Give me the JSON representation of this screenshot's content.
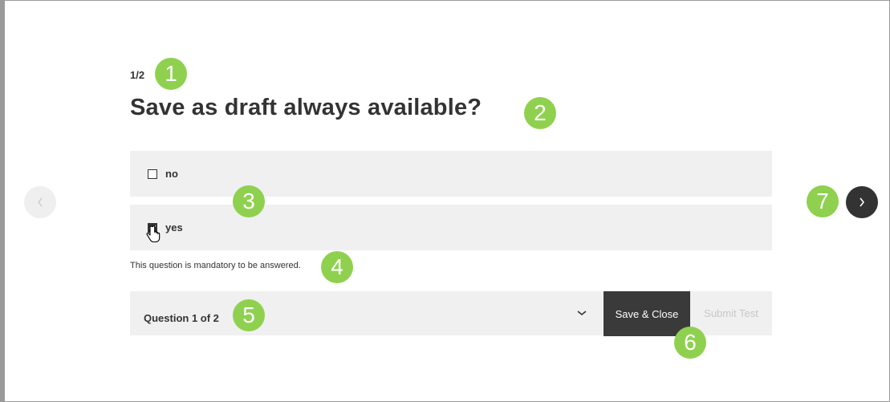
{
  "question": {
    "progress": "1/2",
    "title": "Save as draft always available?",
    "options": [
      {
        "label": "no",
        "checked": false
      },
      {
        "label": "yes",
        "checked": true
      }
    ],
    "mandatory_note": "This question is mandatory to be answered."
  },
  "footer": {
    "question_selector": "Question 1 of 2",
    "save_close_label": "Save & Close",
    "submit_label": "Submit Test"
  },
  "markers": [
    "1",
    "2",
    "3",
    "4",
    "5",
    "6",
    "7"
  ],
  "colors": {
    "marker": "#8fd14f",
    "dark_button": "#3a3a3a",
    "panel": "#f0f0f0",
    "disabled_text": "#c8c8c8"
  },
  "icons": {
    "prev": "chevron-left-icon",
    "next": "chevron-right-icon",
    "dropdown": "chevron-down-icon",
    "cursor": "hand-pointer-icon"
  }
}
